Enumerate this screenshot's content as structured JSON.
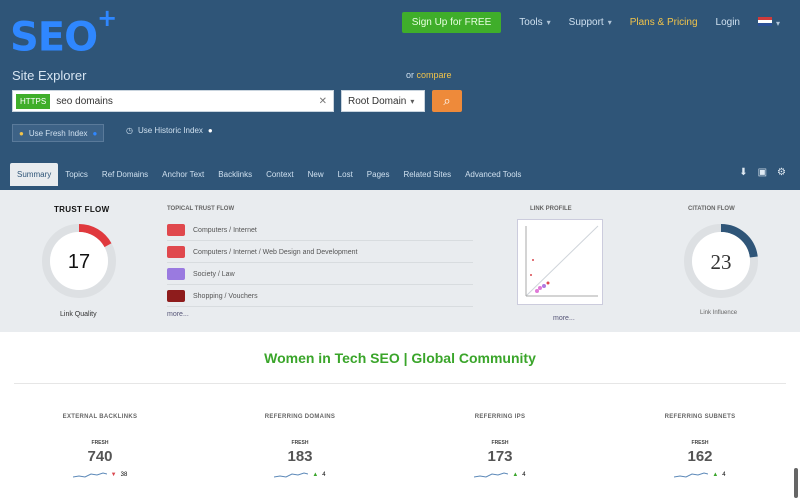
{
  "brand": {
    "logo_text": "SEO",
    "logo_plus": "+"
  },
  "topnav": {
    "signup": "Sign Up for FREE",
    "tools": "Tools",
    "support": "Support",
    "pricing": "Plans & Pricing",
    "login": "Login"
  },
  "site_explorer": {
    "title": "Site Explorer",
    "compare_label": "or",
    "compare_link": "compare",
    "search_tag": "HTTPS",
    "search_value": "seo domains",
    "scope_value": "Root Domain",
    "option_fresh": "Use Fresh Index",
    "option_historic": "Use Historic Index"
  },
  "tabs": [
    "Summary",
    "Topics",
    "Ref Domains",
    "Anchor Text",
    "Backlinks",
    "Context",
    "New",
    "Lost",
    "Pages",
    "Related Sites",
    "Advanced Tools"
  ],
  "trust_flow": {
    "title": "TRUST FLOW",
    "value": "17",
    "subtitle": "Link Quality",
    "fill": 0.17,
    "color": "#e0393e"
  },
  "topical_trust_flow": {
    "title": "TOPICAL TRUST FLOW",
    "items": [
      {
        "label": "Computers / Internet",
        "color": "#e0484d"
      },
      {
        "label": "Computers / Internet / Web Design and Development",
        "color": "#e0484d"
      },
      {
        "label": "Society / Law",
        "color": "#9a7ae0"
      },
      {
        "label": "Shopping / Vouchers",
        "color": "#8e1c1c"
      }
    ],
    "more": "more..."
  },
  "link_profile": {
    "title": "LINK PROFILE",
    "more": "more..."
  },
  "citation_flow": {
    "title": "CITATION FLOW",
    "value": "23",
    "subtitle": "Link Influence",
    "fill": 0.23,
    "color": "#2f5578"
  },
  "main_heading": "Women in Tech SEO | Global Community",
  "stats": [
    {
      "label": "EXTERNAL BACKLINKS",
      "fresh": "FRESH",
      "value": "740",
      "delta": "38",
      "direction": "down"
    },
    {
      "label": "REFERRING DOMAINS",
      "fresh": "FRESH",
      "value": "183",
      "delta": "4",
      "direction": "up"
    },
    {
      "label": "REFERRING IPS",
      "fresh": "FRESH",
      "value": "173",
      "delta": "4",
      "direction": "up"
    },
    {
      "label": "REFERRING SUBNETS",
      "fresh": "FRESH",
      "value": "162",
      "delta": "4",
      "direction": "up"
    }
  ]
}
